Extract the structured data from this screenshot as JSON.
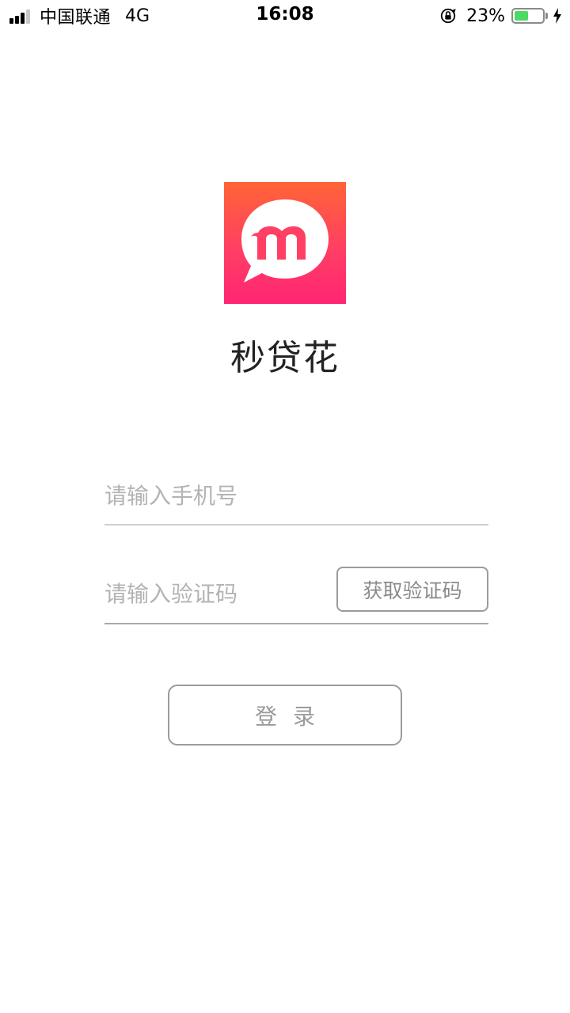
{
  "status_bar": {
    "carrier": "中国联通",
    "network": "4G",
    "time": "16:08",
    "battery_percent_label": "23%",
    "battery_level": 0.23,
    "icons": [
      "signal-icon",
      "rotation-lock-icon",
      "battery-icon",
      "charging-bolt-icon"
    ]
  },
  "app": {
    "logo_icon": "app-logo-icon",
    "name": "秒贷花",
    "brand_colors": {
      "top": "#ff6436",
      "bottom": "#ff2574"
    }
  },
  "form": {
    "phone_placeholder": "请输入手机号",
    "phone_value": "",
    "code_placeholder": "请输入验证码",
    "code_value": "",
    "get_code_label": "获取验证码",
    "login_label": "登录"
  }
}
